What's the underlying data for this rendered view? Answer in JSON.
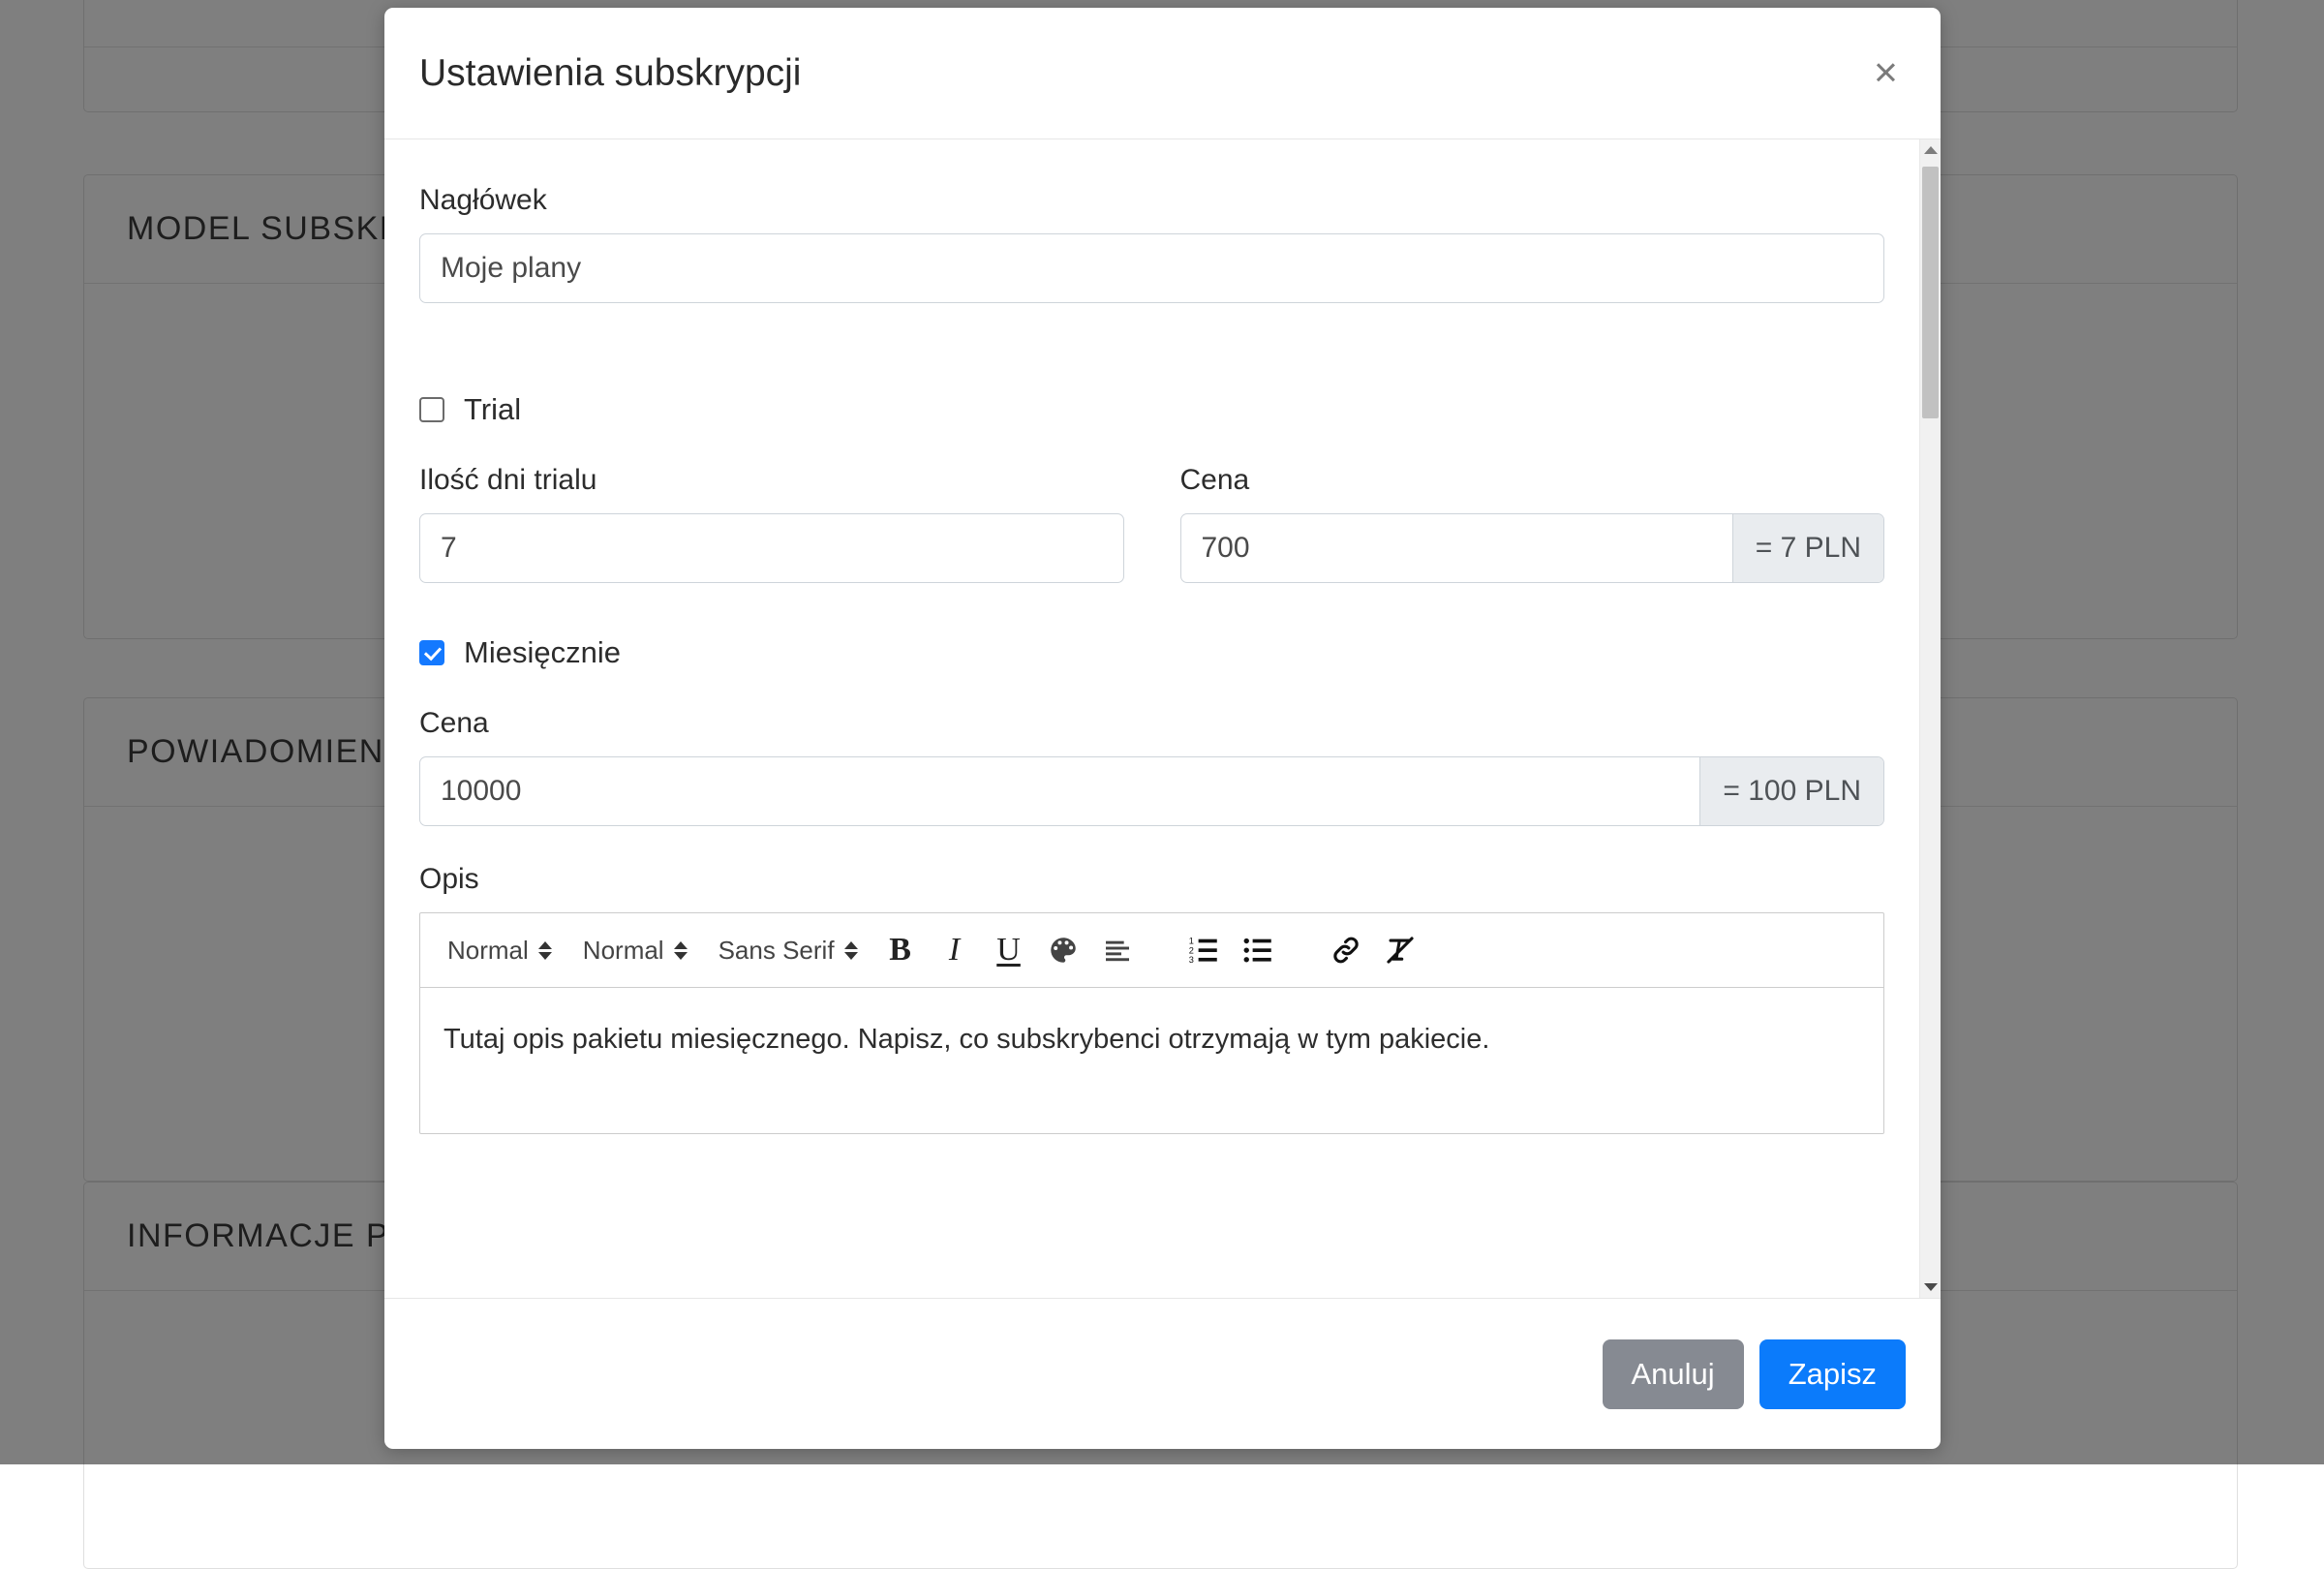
{
  "background": {
    "cards": [
      {
        "title": ""
      },
      {
        "title": "MODEL SUBSKRYPCJI"
      },
      {
        "title": "POWIADOMIENIA"
      },
      {
        "title": "INFORMACJE PODSTAWOWE"
      }
    ]
  },
  "modal": {
    "title": "Ustawienia subskrypcji",
    "close_icon": "close-icon",
    "close_label": "×",
    "header_field": {
      "label": "Nagłówek",
      "value": "Moje plany",
      "placeholder": "Nagłówek"
    },
    "trial": {
      "checkbox_label": "Trial",
      "checked": false,
      "days": {
        "label": "Ilość dni trialu",
        "value": "7",
        "placeholder": "Ilość dni trialu"
      },
      "price": {
        "label": "Cena",
        "value": "700",
        "placeholder": "Cena",
        "addon": "= 7 PLN"
      }
    },
    "monthly": {
      "checkbox_label": "Miesięcznie",
      "checked": true,
      "price": {
        "label": "Cena",
        "value": "10000",
        "placeholder": "Cena",
        "addon": "= 100 PLN"
      },
      "description": {
        "label": "Opis",
        "content": "Tutaj opis pakietu miesięcznego. Napisz, co subskrybenci otrzymają w tym pakiecie."
      }
    },
    "editor_toolbar": {
      "header_select": "Normal",
      "size_select": "Normal",
      "font_select": "Sans Serif",
      "bold_label": "B",
      "italic_label": "I",
      "underline_label": "U",
      "buttons": [
        "bold-icon",
        "italic-icon",
        "underline-icon",
        "color-palette-icon",
        "align-left-icon",
        "ordered-list-icon",
        "bullet-list-icon",
        "link-icon",
        "clear-format-icon"
      ]
    },
    "footer": {
      "cancel_label": "Anuluj",
      "save_label": "Zapisz"
    },
    "scrollbar": {
      "up_icon": "scroll-up-arrow-icon",
      "down_icon": "scroll-down-arrow-icon"
    }
  },
  "colors": {
    "primary": "#0b7bfb",
    "secondary": "#868a92",
    "checkbox_checked": "#1479ff",
    "addon_bg": "#e9ecef",
    "overlay": "rgba(0,0,0,0.5)"
  }
}
